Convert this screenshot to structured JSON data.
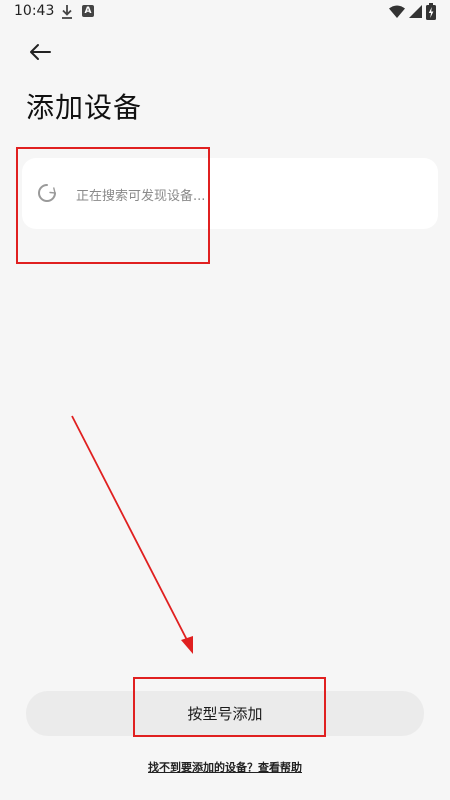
{
  "status_bar": {
    "time": "10:43",
    "app_icon_glyph": "A"
  },
  "header": {
    "back_icon": "arrow-left-icon",
    "title": "添加设备"
  },
  "search": {
    "status_text": "正在搜索可发现设备...",
    "icon": "loading-spinner-icon"
  },
  "footer": {
    "add_by_model_label": "按型号添加",
    "help_link_text": "找不到要添加的设备？查看帮助"
  },
  "colors": {
    "background": "#f6f6f6",
    "card": "#ffffff",
    "button": "#ebebeb",
    "annotation": "#e02020"
  }
}
